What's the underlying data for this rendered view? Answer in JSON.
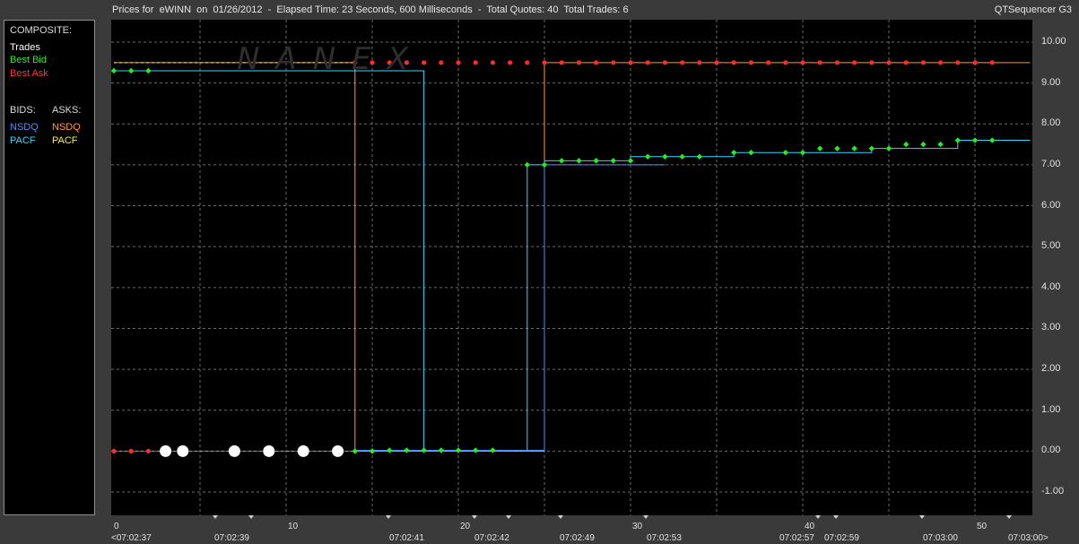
{
  "header": {
    "title": "Prices for  eWINN  on  01/26/2012  -  Elapsed Time: 23 Seconds, 600 Milliseconds  -  Total Quotes: 40  Total Trades: 6",
    "app_name": "QTSequencer G3"
  },
  "watermark": "NANEX",
  "legend": {
    "composite_title": "COMPOSITE:",
    "trades": "Trades",
    "best_bid": "Best Bid",
    "best_ask": "Best Ask",
    "bids_label": "BIDS:",
    "asks_label": "ASKS:",
    "bid_nsdq": "NSDQ",
    "bid_pacf": "PACF",
    "ask_nsdq": "NSDQ",
    "ask_pacf": "PACF",
    "colors": {
      "trades": "#ffffff",
      "best_bid": "#22ee22",
      "best_ask": "#ff2a2a",
      "bid_nsdq": "#4a90ff",
      "bid_pacf": "#33d6ff",
      "ask_nsdq": "#ff9933",
      "ask_pacf": "#ffee33"
    }
  },
  "chart_data": {
    "type": "line",
    "ylim": [
      -1,
      10
    ],
    "xlim": [
      0,
      53.2
    ],
    "yticks": [
      "10.00",
      "9.00",
      "8.00",
      "7.00",
      "6.00",
      "5.00",
      "4.00",
      "3.00",
      "2.00",
      "1.00",
      "0.00",
      "-1.00"
    ],
    "xticks_numeric": [
      {
        "x": 0,
        "label": "0"
      },
      {
        "x": 10,
        "label": "10"
      },
      {
        "x": 20,
        "label": "20"
      },
      {
        "x": 30,
        "label": "30"
      },
      {
        "x": 40,
        "label": "40"
      },
      {
        "x": 50,
        "label": "50"
      }
    ],
    "xticks_time": [
      {
        "x": 0,
        "label": "<07:02:37"
      },
      {
        "x": 10,
        "label": "07:02:39"
      },
      {
        "x": 20,
        "label": "07:02:41"
      },
      {
        "x": 25,
        "label": "07:02:42"
      },
      {
        "x": 30,
        "label": "07:02:49"
      },
      {
        "x": 35,
        "label": "07:02:53"
      },
      {
        "x": 45,
        "label": "07:02:57"
      },
      {
        "x": 50,
        "label": "07:02:59"
      },
      {
        "x": 55,
        "label": "07:03:00"
      },
      {
        "x": 53.2,
        "label": "07:03:00>"
      }
    ],
    "xgrid": [
      0,
      5,
      10,
      15,
      20,
      25,
      30,
      35,
      40,
      45,
      50
    ],
    "trades": [
      {
        "x": 3,
        "y": 0
      },
      {
        "x": 4,
        "y": 0
      },
      {
        "x": 7,
        "y": 0
      },
      {
        "x": 9,
        "y": 0
      },
      {
        "x": 11,
        "y": 0
      },
      {
        "x": 13,
        "y": 0
      }
    ],
    "best_bid": [
      {
        "x": 0,
        "y": 9.3
      },
      {
        "x": 1,
        "y": 9.3
      },
      {
        "x": 2,
        "y": 9.3
      },
      {
        "x": 14,
        "y": 0
      },
      {
        "x": 15,
        "y": 0
      },
      {
        "x": 16,
        "y": 0.02
      },
      {
        "x": 17,
        "y": 0.02
      },
      {
        "x": 18,
        "y": 0.02
      },
      {
        "x": 19,
        "y": 0.02
      },
      {
        "x": 20,
        "y": 0.02
      },
      {
        "x": 21,
        "y": 0.02
      },
      {
        "x": 22,
        "y": 0.02
      },
      {
        "x": 24,
        "y": 7.0
      },
      {
        "x": 25,
        "y": 7.0
      },
      {
        "x": 26,
        "y": 7.1
      },
      {
        "x": 27,
        "y": 7.1
      },
      {
        "x": 28,
        "y": 7.1
      },
      {
        "x": 29,
        "y": 7.1
      },
      {
        "x": 30,
        "y": 7.1
      },
      {
        "x": 31,
        "y": 7.2
      },
      {
        "x": 32,
        "y": 7.2
      },
      {
        "x": 33,
        "y": 7.2
      },
      {
        "x": 34,
        "y": 7.2
      },
      {
        "x": 36,
        "y": 7.3
      },
      {
        "x": 37,
        "y": 7.3
      },
      {
        "x": 39,
        "y": 7.3
      },
      {
        "x": 40,
        "y": 7.3
      },
      {
        "x": 41,
        "y": 7.4
      },
      {
        "x": 42,
        "y": 7.4
      },
      {
        "x": 43,
        "y": 7.4
      },
      {
        "x": 44,
        "y": 7.4
      },
      {
        "x": 45,
        "y": 7.4
      },
      {
        "x": 46,
        "y": 7.5
      },
      {
        "x": 47,
        "y": 7.5
      },
      {
        "x": 48,
        "y": 7.5
      },
      {
        "x": 49,
        "y": 7.6
      },
      {
        "x": 50,
        "y": 7.6
      },
      {
        "x": 51,
        "y": 7.6
      }
    ],
    "best_ask": [
      {
        "x": 0,
        "y": 0
      },
      {
        "x": 1,
        "y": 0
      },
      {
        "x": 2,
        "y": 0
      },
      {
        "x": 14,
        "y": 9.5
      },
      {
        "x": 15,
        "y": 9.5
      },
      {
        "x": 16,
        "y": 9.5
      },
      {
        "x": 17,
        "y": 9.5
      },
      {
        "x": 18,
        "y": 9.5
      },
      {
        "x": 19,
        "y": 9.5
      },
      {
        "x": 20,
        "y": 9.5
      },
      {
        "x": 21,
        "y": 9.5
      },
      {
        "x": 22,
        "y": 9.5
      },
      {
        "x": 23,
        "y": 9.5
      },
      {
        "x": 24,
        "y": 9.5
      },
      {
        "x": 25,
        "y": 9.5
      },
      {
        "x": 26,
        "y": 9.5
      },
      {
        "x": 27,
        "y": 9.5
      },
      {
        "x": 28,
        "y": 9.5
      },
      {
        "x": 29,
        "y": 9.5
      },
      {
        "x": 30,
        "y": 9.5
      },
      {
        "x": 31,
        "y": 9.5
      },
      {
        "x": 32,
        "y": 9.5
      },
      {
        "x": 33,
        "y": 9.5
      },
      {
        "x": 34,
        "y": 9.5
      },
      {
        "x": 35,
        "y": 9.5
      },
      {
        "x": 36,
        "y": 9.5
      },
      {
        "x": 37,
        "y": 9.5
      },
      {
        "x": 38,
        "y": 9.5
      },
      {
        "x": 39,
        "y": 9.5
      },
      {
        "x": 40,
        "y": 9.5
      },
      {
        "x": 41,
        "y": 9.5
      },
      {
        "x": 42,
        "y": 9.5
      },
      {
        "x": 43,
        "y": 9.5
      },
      {
        "x": 44,
        "y": 9.5
      },
      {
        "x": 45,
        "y": 9.5
      },
      {
        "x": 46,
        "y": 9.5
      },
      {
        "x": 47,
        "y": 9.5
      },
      {
        "x": 48,
        "y": 9.5
      },
      {
        "x": 49,
        "y": 9.5
      },
      {
        "x": 50,
        "y": 9.5
      },
      {
        "x": 51,
        "y": 9.5
      }
    ],
    "pacf_bid_step": [
      [
        0,
        9.3
      ],
      [
        18,
        9.3
      ],
      [
        18,
        0.02
      ],
      [
        24,
        0.02
      ],
      [
        24,
        7.0
      ],
      [
        25,
        7.0
      ],
      [
        25,
        7.1
      ],
      [
        30,
        7.1
      ],
      [
        30,
        7.2
      ],
      [
        36,
        7.2
      ],
      [
        36,
        7.3
      ],
      [
        44,
        7.3
      ],
      [
        44,
        7.4
      ],
      [
        49,
        7.4
      ],
      [
        49,
        7.6
      ],
      [
        53.2,
        7.6
      ]
    ],
    "nsdq_ask_step": [
      [
        0,
        9.5
      ],
      [
        14,
        9.5
      ],
      [
        14,
        0
      ],
      [
        25,
        0
      ],
      [
        25,
        9.5
      ],
      [
        53.2,
        9.5
      ]
    ],
    "nsdq_bid_step": [
      [
        14,
        0.02
      ],
      [
        25,
        0.02
      ],
      [
        25,
        7.0
      ],
      [
        32,
        7.0
      ]
    ]
  }
}
